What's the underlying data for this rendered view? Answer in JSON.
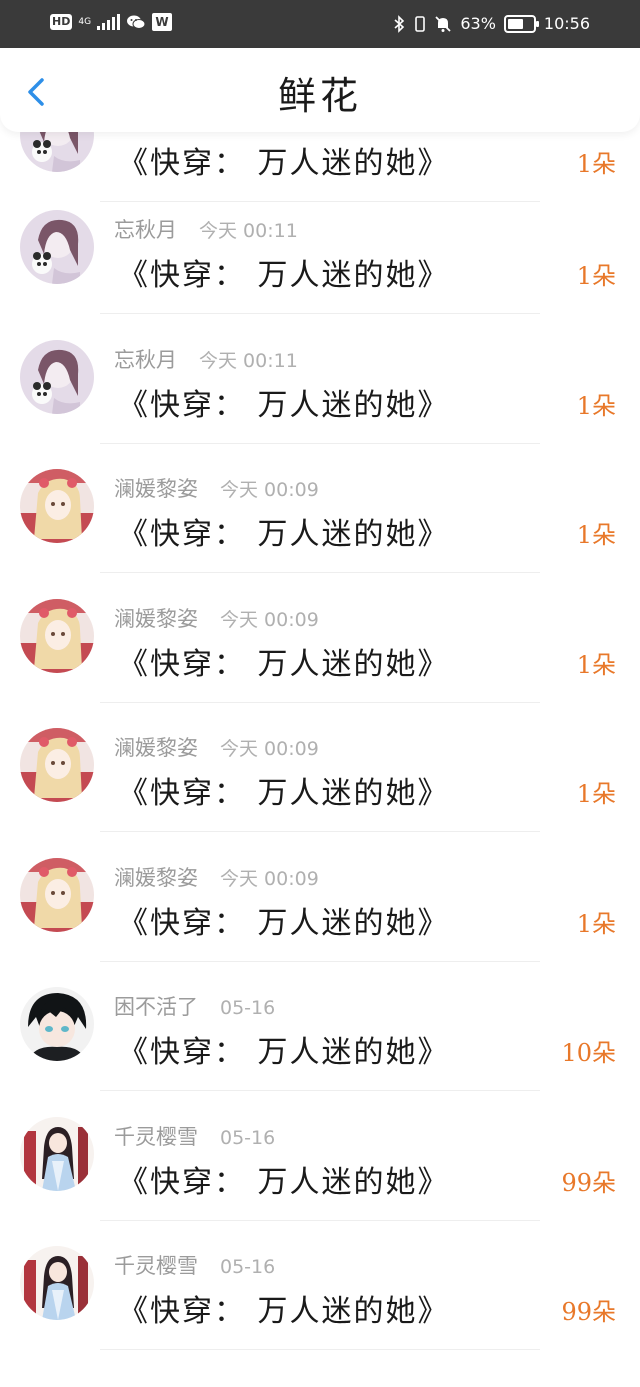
{
  "status_bar": {
    "hd": "HD",
    "network": "4G",
    "wps": "W",
    "battery_percent": "63%",
    "battery_level": 0.63,
    "time": "10:56"
  },
  "header": {
    "title": "鲜花"
  },
  "colors": {
    "accent": "#2e8fe8",
    "count": "#e8782a",
    "status_bg": "#3a3a3a"
  },
  "records": [
    {
      "user": "",
      "time": "",
      "book": "《快穿： 万人迷的她》",
      "count": "1朵",
      "avatar": "pink-girl-avatar"
    },
    {
      "user": "忘秋月",
      "time": "今天 00:11",
      "book": "《快穿： 万人迷的她》",
      "count": "1朵",
      "avatar": "pink-girl-avatar"
    },
    {
      "user": "忘秋月",
      "time": "今天 00:11",
      "book": "《快穿： 万人迷的她》",
      "count": "1朵",
      "avatar": "pink-girl-avatar"
    },
    {
      "user": "澜媛黎姿",
      "time": "今天 00:09",
      "book": "《快穿： 万人迷的她》",
      "count": "1朵",
      "avatar": "red-blonde-avatar"
    },
    {
      "user": "澜媛黎姿",
      "time": "今天 00:09",
      "book": "《快穿： 万人迷的她》",
      "count": "1朵",
      "avatar": "red-blonde-avatar"
    },
    {
      "user": "澜媛黎姿",
      "time": "今天 00:09",
      "book": "《快穿： 万人迷的她》",
      "count": "1朵",
      "avatar": "red-blonde-avatar"
    },
    {
      "user": "澜媛黎姿",
      "time": "今天 00:09",
      "book": "《快穿： 万人迷的她》",
      "count": "1朵",
      "avatar": "red-blonde-avatar"
    },
    {
      "user": "困不活了",
      "time": "05-16",
      "book": "《快穿： 万人迷的她》",
      "count": "10朵",
      "avatar": "dark-boy-avatar"
    },
    {
      "user": "千灵樱雪",
      "time": "05-16",
      "book": "《快穿： 万人迷的她》",
      "count": "99朵",
      "avatar": "hanfu-girl-avatar"
    },
    {
      "user": "千灵樱雪",
      "time": "05-16",
      "book": "《快穿： 万人迷的她》",
      "count": "99朵",
      "avatar": "hanfu-girl-avatar"
    }
  ]
}
